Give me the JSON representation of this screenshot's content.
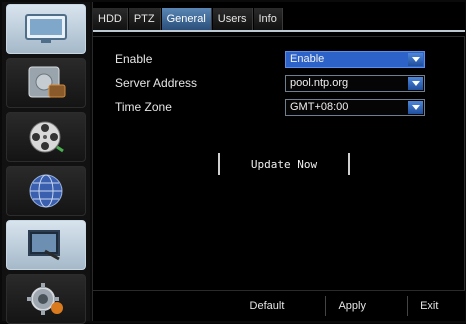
{
  "sidebar": {
    "items": [
      {
        "name": "monitor-icon",
        "active": false
      },
      {
        "name": "record-icon",
        "active": false
      },
      {
        "name": "playback-reel-icon",
        "active": false
      },
      {
        "name": "network-globe-icon",
        "active": false
      },
      {
        "name": "system-display-icon",
        "active": true
      },
      {
        "name": "settings-gear-icon",
        "active": false
      }
    ]
  },
  "tabs": [
    {
      "label": "HDD",
      "active": false
    },
    {
      "label": "PTZ",
      "active": false
    },
    {
      "label": "General",
      "active": true
    },
    {
      "label": "Users",
      "active": false
    },
    {
      "label": "Info",
      "active": false
    }
  ],
  "form": {
    "enable": {
      "label": "Enable",
      "value": "Enable"
    },
    "server_address": {
      "label": "Server Address",
      "value": "pool.ntp.org"
    },
    "time_zone": {
      "label": "Time Zone",
      "value": "GMT+08:00"
    }
  },
  "update_button": "Update Now",
  "footer": {
    "default": "Default",
    "apply": "Apply",
    "exit": "Exit"
  },
  "colors": {
    "accent": "#2d63c9",
    "tab_active": "#3f6b9b"
  }
}
